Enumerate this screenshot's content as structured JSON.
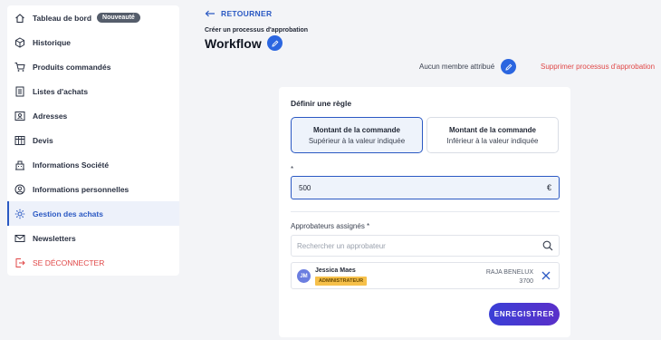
{
  "sidebar": {
    "items": [
      {
        "label": "Tableau de bord",
        "icon": "home-icon",
        "badge": "Nouveauté"
      },
      {
        "label": "Historique",
        "icon": "box-icon"
      },
      {
        "label": "Produits commandés",
        "icon": "cart-icon"
      },
      {
        "label": "Listes d'achats",
        "icon": "list-icon"
      },
      {
        "label": "Adresses",
        "icon": "address-card-icon"
      },
      {
        "label": "Devis",
        "icon": "table-icon"
      },
      {
        "label": "Informations Société",
        "icon": "building-icon"
      },
      {
        "label": "Informations personnelles",
        "icon": "user-circle-icon"
      },
      {
        "label": "Gestion des achats",
        "icon": "gear-icon",
        "active": true
      },
      {
        "label": "Newsletters",
        "icon": "mail-icon"
      },
      {
        "label": "SE DÉCONNECTER",
        "icon": "logout-icon"
      }
    ]
  },
  "header": {
    "back_label": "RETOURNER",
    "subtitle": "Créer un processus d'approbation",
    "title": "Workflow",
    "no_member": "Aucun membre attribué",
    "delete_label": "Supprimer processus d'approbation"
  },
  "rule": {
    "title": "Définir une règle",
    "options": [
      {
        "line1": "Montant de la commande",
        "line2": "Supérieur à la valeur indiquée",
        "selected": true
      },
      {
        "line1": "Montant de la commande",
        "line2": "Inférieur à la valeur indiquée",
        "selected": false
      }
    ],
    "required_marker": "*",
    "amount_value": "500",
    "currency": "€"
  },
  "approvers": {
    "label": "Approbateurs assignés *",
    "search_placeholder": "Rechercher un approbateur",
    "assigned": [
      {
        "initials": "JM",
        "name": "Jessica Maes",
        "role": "ADMINISTRATEUR",
        "company": "RAJA BENELUX",
        "company_code": "3700"
      }
    ]
  },
  "save_label": "ENREGISTRER",
  "colors": {
    "accent": "#2b59c3",
    "danger": "#e04848",
    "role_badge": "#f6c04a"
  }
}
